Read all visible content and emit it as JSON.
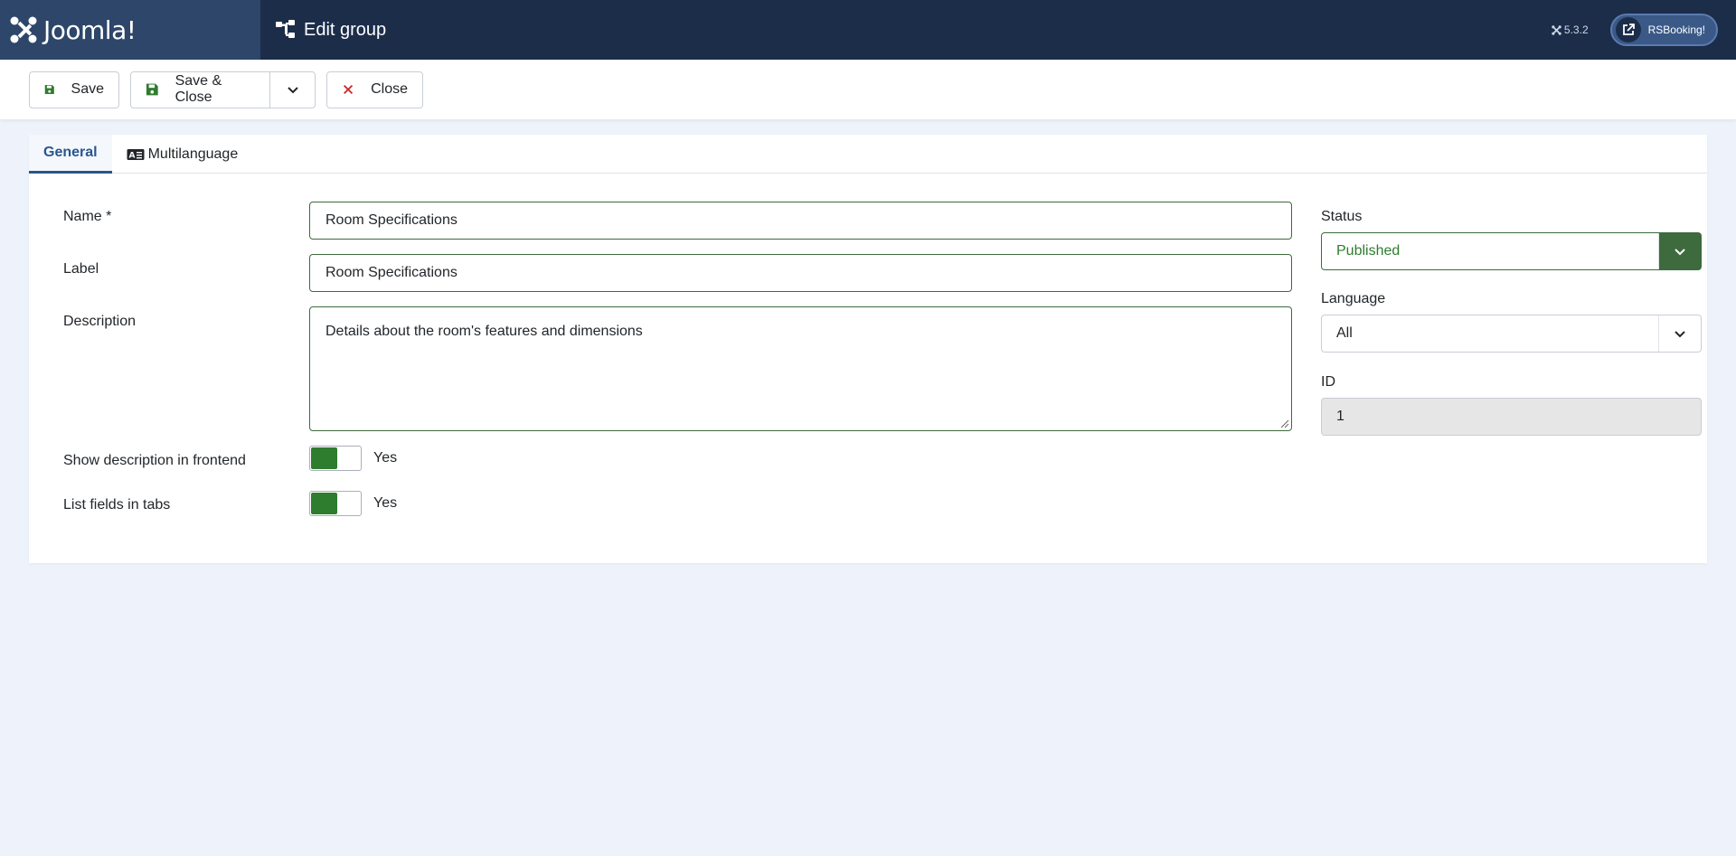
{
  "header": {
    "logo_text": "Joomla!",
    "page_title": "Edit group",
    "version": "5.3.2",
    "external_link_label": "RSBooking!"
  },
  "toolbar": {
    "save_label": "Save",
    "save_close_label": "Save & Close",
    "close_label": "Close"
  },
  "tabs": [
    {
      "label": "General",
      "active": true
    },
    {
      "label": "Multilanguage",
      "active": false
    }
  ],
  "form": {
    "name_label": "Name *",
    "name_value": "Room Specifications",
    "label_label": "Label",
    "label_value": "Room Specifications",
    "description_label": "Description",
    "description_value": "Details about the room's features and dimensions",
    "show_desc_label": "Show description in frontend",
    "show_desc_value": "Yes",
    "list_tabs_label": "List fields in tabs",
    "list_tabs_value": "Yes"
  },
  "sidebar": {
    "status_label": "Status",
    "status_value": "Published",
    "language_label": "Language",
    "language_value": "All",
    "id_label": "ID",
    "id_value": "1"
  },
  "colors": {
    "header_bg": "#1c2d4a",
    "logo_bg": "#2d4669",
    "accent_green": "#2e7c2e",
    "tab_active": "#2a5590",
    "page_bg": "#eef3fb"
  }
}
